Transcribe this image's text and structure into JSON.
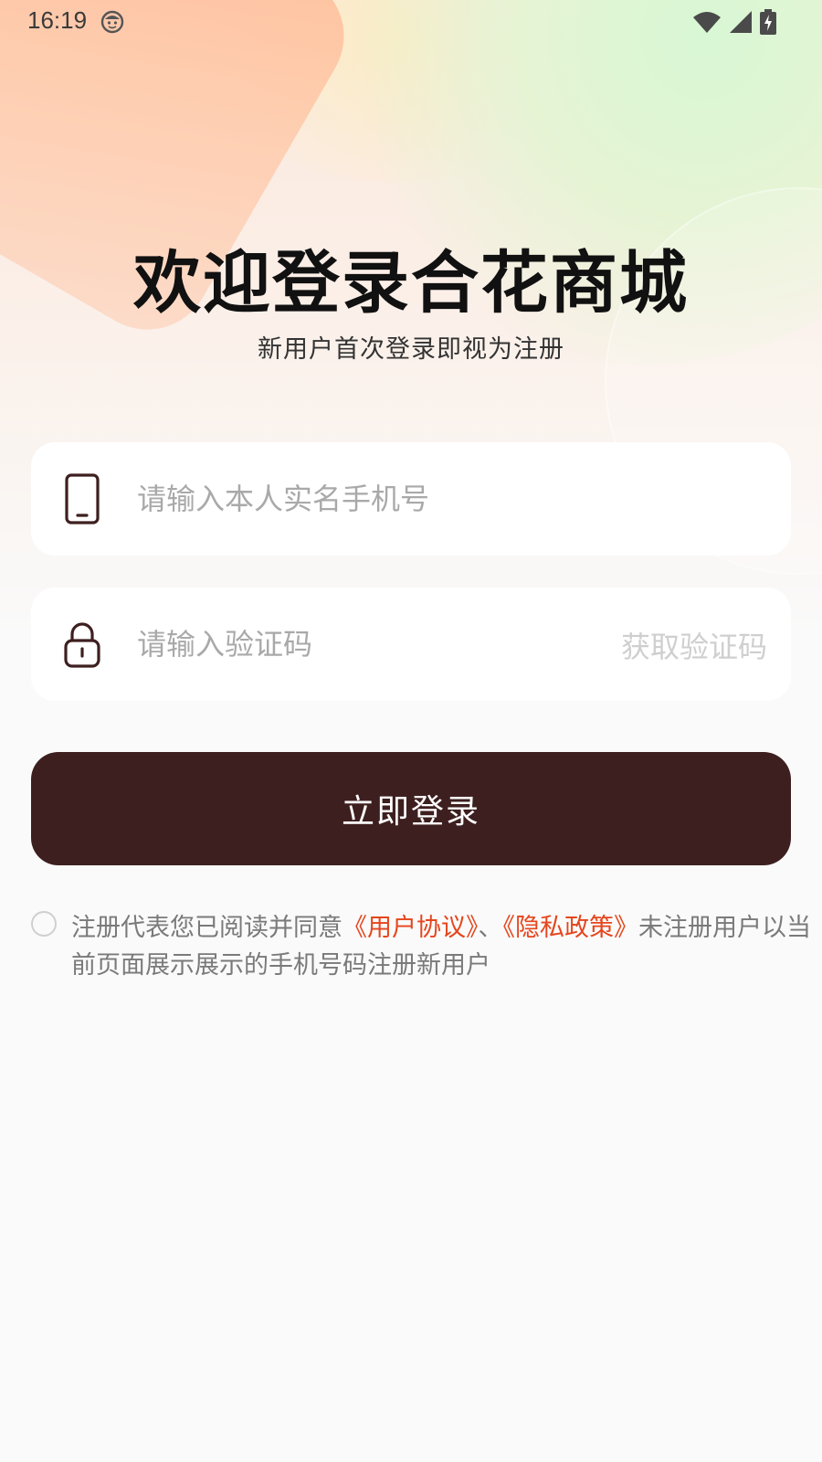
{
  "status_bar": {
    "time": "16:19"
  },
  "login": {
    "title": "欢迎登录合花商城",
    "subtitle": "新用户首次登录即视为注册",
    "phone_placeholder": "请输入本人实名手机号",
    "code_placeholder": "请输入验证码",
    "get_code_label": "获取验证码",
    "login_button_label": "立即登录"
  },
  "agreement": {
    "prefix": "注册代表您已阅读并同意",
    "user_agreement": "《用户协议》",
    "separator": "、",
    "privacy_policy": "《隐私政策》",
    "suffix": "未注册用户以当前页面展示展示的手机号码注册新用户"
  },
  "colors": {
    "primary_button": "#3e1f1f",
    "link": "#e5461d",
    "placeholder": "#a9a9a9"
  },
  "icons": {
    "phone": "phone-icon",
    "lock": "lock-icon",
    "wifi": "wifi-icon",
    "signal": "signal-icon",
    "battery": "battery-charging-icon"
  }
}
